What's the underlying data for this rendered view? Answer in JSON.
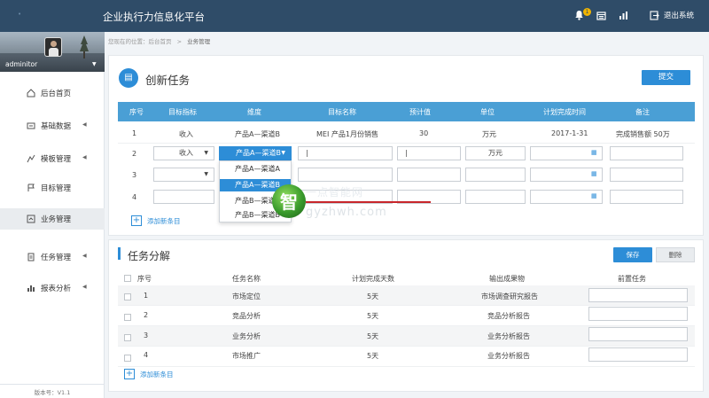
{
  "header": {
    "title": "企业执行力信息化平台",
    "notification_count": "1",
    "logout_label": "退出系统"
  },
  "sidebar": {
    "username": "adminitor",
    "items": [
      {
        "label": "后台首页",
        "icon": "home-icon",
        "has_arrow": false
      },
      {
        "label": "基础数据",
        "icon": "database-icon",
        "has_arrow": true
      },
      {
        "label": "模板管理",
        "icon": "template-icon",
        "has_arrow": true
      },
      {
        "label": "目标管理",
        "icon": "target-icon",
        "has_arrow": false
      },
      {
        "label": "业务管理",
        "icon": "business-icon",
        "has_arrow": false,
        "active": true
      },
      {
        "label": "任务管理",
        "icon": "task-icon",
        "has_arrow": true
      },
      {
        "label": "报表分析",
        "icon": "chart-icon",
        "has_arrow": true
      }
    ],
    "version": "版本号：V1.1"
  },
  "breadcrumb": {
    "prefix": "您现在的位置：",
    "home": "后台首页",
    "sep": ">",
    "current": "业务管理"
  },
  "create_task": {
    "title": "创新任务",
    "submit_label": "提交",
    "columns": [
      "序号",
      "目标指标",
      "维度",
      "目标名称",
      "预计值",
      "单位",
      "计划完成时间",
      "备注"
    ],
    "row1": {
      "no": "1",
      "indicator": "收入",
      "dimension": "产品A—渠道B",
      "name": "MEI 产品1月份销售",
      "expected": "30",
      "unit": "万元",
      "date": "2017-1-31",
      "note": "完成销售额 50万"
    },
    "row2": {
      "no": "2",
      "indicator": "收入",
      "dimension": "产品A—渠道B",
      "name_cursor": "|",
      "expected_cursor": "|",
      "unit": "万元"
    },
    "row3": {
      "no": "3"
    },
    "row4": {
      "no": "4"
    },
    "dropdown_options": [
      "产品A—渠道A",
      "产品A—渠道B",
      "产品B—渠道A",
      "产品B—渠道B"
    ],
    "add_label": "添加新条目"
  },
  "decompose": {
    "title": "任务分解",
    "save_label": "保存",
    "delete_label": "删除",
    "columns": [
      "序号",
      "任务名称",
      "计划完成天数",
      "输出成果物",
      "前置任务"
    ],
    "rows": [
      {
        "no": "1",
        "name": "市场定位",
        "days": "5天",
        "output": "市场调查研究报告"
      },
      {
        "no": "2",
        "name": "竞品分析",
        "days": "5天",
        "output": "竞品分析报告"
      },
      {
        "no": "3",
        "name": "业务分析",
        "days": "5天",
        "output": "业务分析报告"
      },
      {
        "no": "4",
        "name": "市场推广",
        "days": "5天",
        "output": "业务分析报告"
      }
    ],
    "add_label": "添加新条目"
  },
  "watermark": {
    "char": "智",
    "text_top": "一点智能网",
    "text_bottom": "gyzhwh.com"
  },
  "colors": {
    "topbar": "#2f4c68",
    "accent": "#2d8dd7",
    "table_header": "#4a9fd5"
  }
}
